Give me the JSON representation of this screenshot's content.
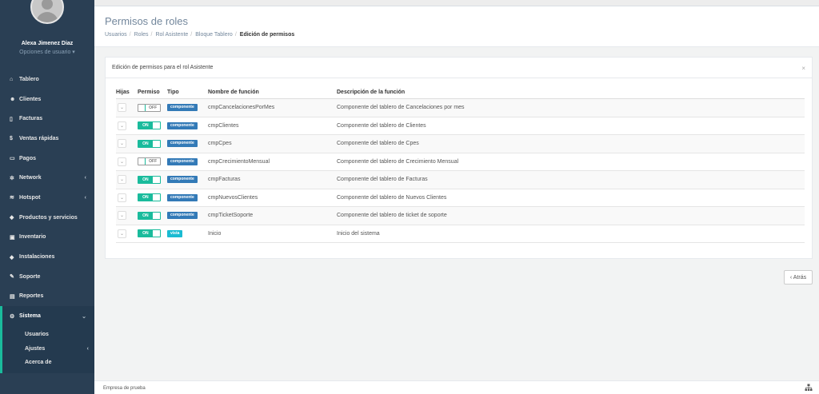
{
  "sidebar": {
    "user_name": "Alexa Jimenez Diaz",
    "user_options": "Opciones de usuario ▾",
    "items": [
      {
        "icon": "dashboard-icon",
        "glyph": "⌂",
        "label": "Tablero"
      },
      {
        "icon": "users-icon",
        "glyph": "☻",
        "label": "Clientes"
      },
      {
        "icon": "file-icon",
        "glyph": "▯",
        "label": "Facturas"
      },
      {
        "icon": "dollar-icon",
        "glyph": "$",
        "label": "Ventas rápidas"
      },
      {
        "icon": "money-icon",
        "glyph": "▭",
        "label": "Pagos"
      },
      {
        "icon": "network-icon",
        "glyph": "✲",
        "label": "Network",
        "chevron": "‹"
      },
      {
        "icon": "wifi-icon",
        "glyph": "≋",
        "label": "Hotspot",
        "chevron": "‹"
      },
      {
        "icon": "tags-icon",
        "glyph": "◆",
        "label": "Productos y servicios"
      },
      {
        "icon": "cubes-icon",
        "glyph": "▣",
        "label": "Inventario"
      },
      {
        "icon": "wrench-icon",
        "glyph": "◆",
        "label": "Instalaciones"
      },
      {
        "icon": "tool-icon",
        "glyph": "✎",
        "label": "Soporte"
      },
      {
        "icon": "report-icon",
        "glyph": "▤",
        "label": "Reportes"
      }
    ],
    "active_item": {
      "icon": "cogs-icon",
      "glyph": "⚙",
      "label": "Sistema",
      "chevron": "⌄"
    },
    "sub_items": [
      {
        "label": "Usuarios"
      },
      {
        "label": "Ajustes",
        "chevron": "‹"
      },
      {
        "label": "Acerca de"
      }
    ]
  },
  "header": {
    "title": "Permisos de roles",
    "breadcrumb": [
      "Usuarios",
      "Roles",
      "Rol Asistente",
      "Bloque Tablero"
    ],
    "breadcrumb_current": "Edición de permisos"
  },
  "panel": {
    "title": "Edición de permisos para el rol Asistente",
    "close": "×"
  },
  "table": {
    "headers": {
      "hijas": "Hijas",
      "permiso": "Permiso",
      "tipo": "Tipo",
      "nombre": "Nombre de función",
      "descripcion": "Descripción de la función"
    },
    "expand_glyph": "⌄",
    "on_label": "ON",
    "off_label": "OFF",
    "rows": [
      {
        "permiso": "OFF",
        "tipo": "componente",
        "nombre": "cmpCancelacionesPorMes",
        "descripcion": "Componente del tablero de Cancelaciones por mes"
      },
      {
        "permiso": "ON",
        "tipo": "componente",
        "nombre": "cmpClientes",
        "descripcion": "Componente del tablero de Clientes"
      },
      {
        "permiso": "ON",
        "tipo": "componente",
        "nombre": "cmpCpes",
        "descripcion": "Componente del tablero de Cpes"
      },
      {
        "permiso": "OFF",
        "tipo": "componente",
        "nombre": "cmpCrecimientoMensual",
        "descripcion": "Componente del tablero de Crecimiento Mensual"
      },
      {
        "permiso": "ON",
        "tipo": "componente",
        "nombre": "cmpFacturas",
        "descripcion": "Componente del tablero de Facturas"
      },
      {
        "permiso": "ON",
        "tipo": "componente",
        "nombre": "cmpNuevosClientes",
        "descripcion": "Componente del tablero de Nuevos Clientes"
      },
      {
        "permiso": "ON",
        "tipo": "componente",
        "nombre": "cmpTicketSoporte",
        "descripcion": "Componente del tablero de ticket de soporte"
      },
      {
        "permiso": "ON",
        "tipo": "vista",
        "nombre": "Inicio",
        "descripcion": "Inicio del sistema"
      }
    ]
  },
  "back_button": "‹ Atrás",
  "footer": {
    "text": "Empresa de prueba",
    "icon": "sitemap-icon"
  },
  "colors": {
    "sidebar": "#2a3f54",
    "accent": "#1abb9c",
    "badge_component": "#337ab7",
    "badge_view": "#1abbd2"
  }
}
